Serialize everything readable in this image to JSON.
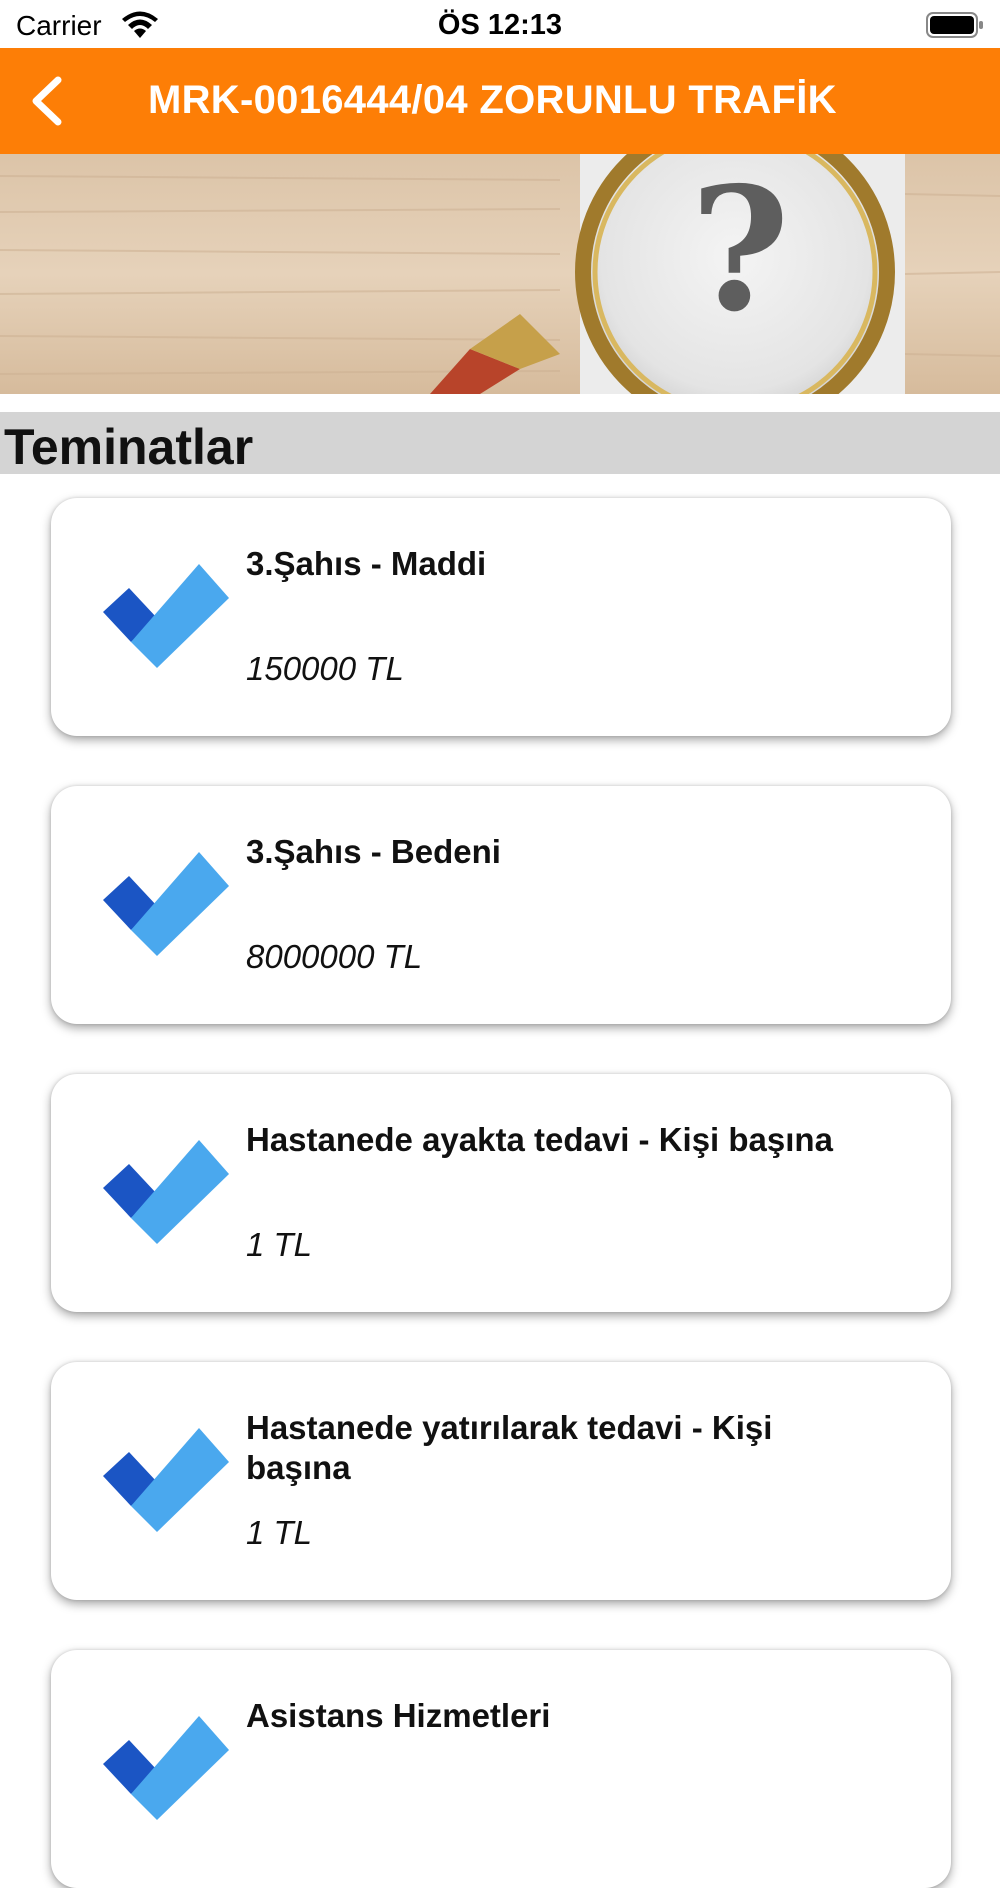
{
  "status_bar": {
    "carrier": "Carrier",
    "time": "ÖS 12:13"
  },
  "nav": {
    "back_icon": "chevron-left-icon",
    "title": "MRK-0016444/04 ZORUNLU TRAFİK"
  },
  "banner": {
    "image": "magnifier-question-mark-icon"
  },
  "section": {
    "title": "Teminatlar"
  },
  "coverages": [
    {
      "name": "3.Şahıs - Maddi",
      "amount": "150000 TL"
    },
    {
      "name": "3.Şahıs - Bedeni",
      "amount": "8000000 TL"
    },
    {
      "name": "Hastanede ayakta tedavi - Kişi başına",
      "amount": "1 TL"
    },
    {
      "name": "Hastanede yatırılarak tedavi - Kişi başına",
      "amount": "1 TL"
    },
    {
      "name": "Asistans Hizmetleri",
      "amount": ""
    }
  ],
  "colors": {
    "accent": "#fd7e06",
    "section_bg": "#d4d4d4",
    "check_dark": "#1b55c4",
    "check_light": "#4aa8ee"
  }
}
